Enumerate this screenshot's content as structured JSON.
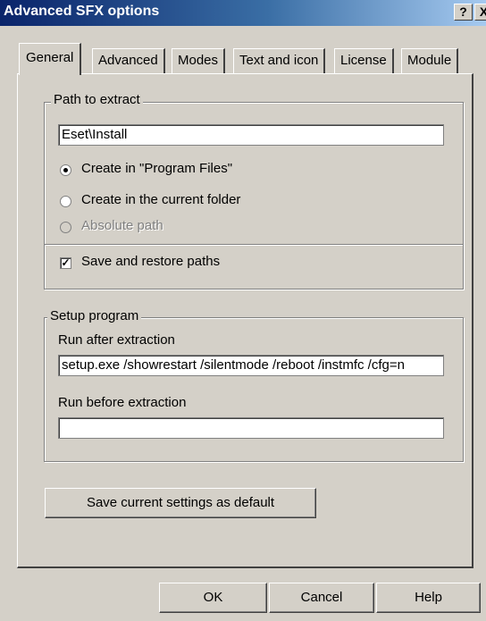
{
  "window": {
    "title": "Advanced SFX options",
    "help_glyph": "?",
    "close_glyph": "X"
  },
  "tabs": [
    "General",
    "Advanced",
    "Modes",
    "Text and icon",
    "License",
    "Module"
  ],
  "path_group": {
    "label": "Path to extract",
    "path_value": "Eset\\Install",
    "options": [
      {
        "label": "Create in \"Program Files\"",
        "selected": true,
        "enabled": true
      },
      {
        "label": "Create in the current folder",
        "selected": false,
        "enabled": true
      },
      {
        "label": "Absolute path",
        "selected": false,
        "enabled": false
      }
    ],
    "save_restore_label": "Save and restore paths",
    "save_restore_checked": true,
    "check_glyph": "✓"
  },
  "setup_group": {
    "label": "Setup program",
    "run_after_label": "Run after extraction",
    "run_after_value": "setup.exe /showrestart /silentmode /reboot /instmfc /cfg=n",
    "run_before_label": "Run before extraction",
    "run_before_value": ""
  },
  "save_default_label": "Save current settings as default",
  "buttons": {
    "ok": "OK",
    "cancel": "Cancel",
    "help": "Help"
  }
}
